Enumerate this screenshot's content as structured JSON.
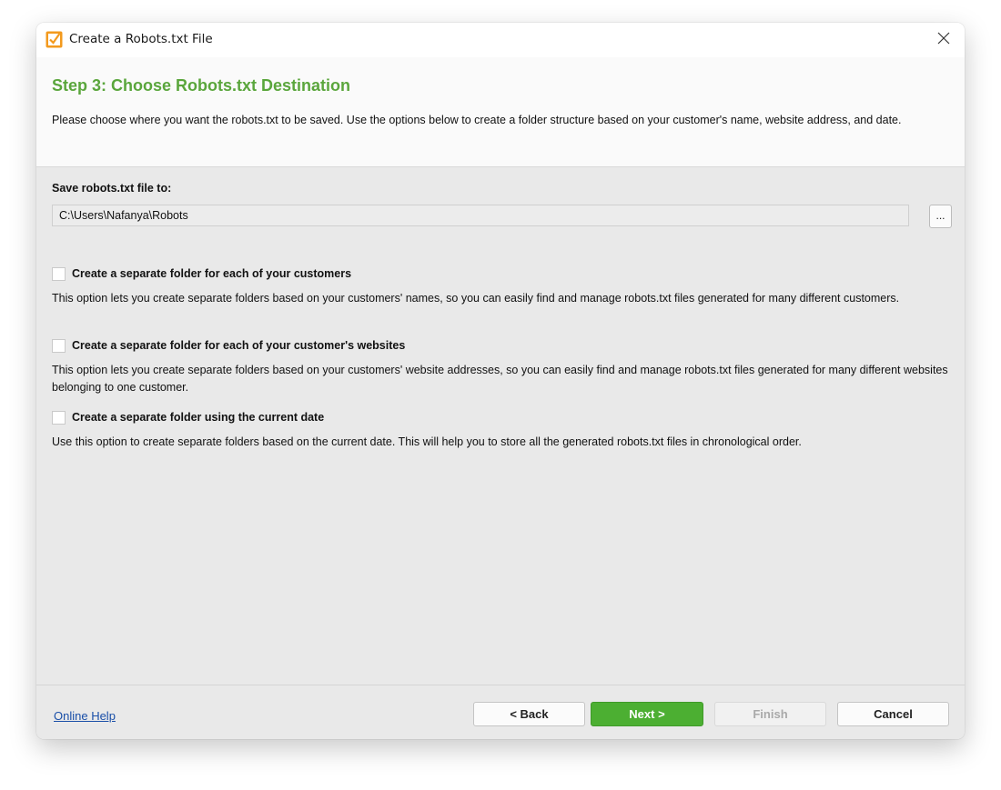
{
  "window": {
    "title": "Create a Robots.txt File",
    "app_icon": "robots-app-icon",
    "close_icon": "close-icon",
    "accent_color": "#5aa63c"
  },
  "header": {
    "step_title": "Step 3: Choose Robots.txt Destination",
    "description": "Please choose where you want the robots.txt to be saved. Use the options below to create a folder structure based on your customer's name, website address, and date."
  },
  "destination": {
    "label": "Save robots.txt file to:",
    "path_value": "C:\\Users\\Nafanya\\Robots",
    "browse_label": "..."
  },
  "options": [
    {
      "label": "Create a separate folder for each of your customers",
      "description": "This option lets you create separate folders based on your customers' names, so you can easily find and manage robots.txt files generated for many different customers.",
      "checked": false
    },
    {
      "label": "Create a separate folder for each of your customer's websites",
      "description": "This option lets you create separate folders based on your customers' website addresses, so you can easily find and manage robots.txt files generated for many different websites belonging to one customer.",
      "checked": false
    },
    {
      "label": "Create a separate folder using the current date",
      "description": "Use this option to create separate folders based on the current date. This will help you to store all the generated robots.txt files in chronological order.",
      "checked": false
    }
  ],
  "footer": {
    "help_link": "Online Help",
    "back_label": "< Back",
    "next_label": "Next >",
    "finish_label": "Finish",
    "cancel_label": "Cancel",
    "next_color": "#4caf32"
  }
}
